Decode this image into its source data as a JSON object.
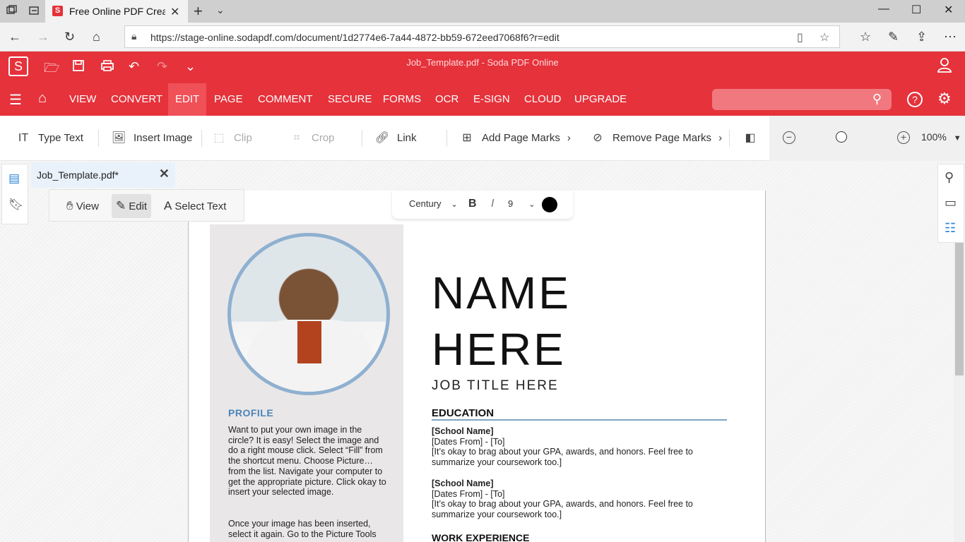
{
  "browser": {
    "tab_title": "Free Online PDF Creator",
    "favicon_letter": "S",
    "url": "https://stage-online.sodapdf.com/document/1d2774e6-7a44-4872-bb59-672eed7068f6?r=edit"
  },
  "app": {
    "logo": "S",
    "document_title": "Job_Template.pdf - Soda PDF Online",
    "menu": [
      "VIEW",
      "CONVERT",
      "EDIT",
      "PAGE",
      "COMMENT",
      "SECURE",
      "FORMS",
      "OCR",
      "E-SIGN",
      "CLOUD",
      "UPGRADE"
    ],
    "active_menu": "EDIT",
    "help_label": "?"
  },
  "ribbon": {
    "type_text": "Type Text",
    "insert_image": "Insert Image",
    "clip": "Clip",
    "crop": "Crop",
    "link": "Link",
    "add_page_marks": "Add Page Marks",
    "remove_page_marks": "Remove Page Marks",
    "zoom": "100%"
  },
  "workspace": {
    "doc_tab": "Job_Template.pdf*",
    "modes": {
      "view": "View",
      "edit": "Edit",
      "select_text": "Select Text"
    },
    "font": {
      "family": "Century",
      "bold": "B",
      "italic": "I",
      "size": "9",
      "color": "#000000"
    }
  },
  "resume": {
    "name_line1": "NAME",
    "name_line2": "HERE",
    "job_title": "JOB TITLE HERE",
    "profile_heading": "PROFILE",
    "profile_text": "Want to put your own image in the circle?  It is easy!  Select the image and do a right mouse click.  Select “Fill” from the shortcut menu.  Choose Picture… from the list.  Navigate your computer to get the appropriate picture.  Click okay to insert your selected image.",
    "profile_text2": "Once your image has been inserted, select it again.  Go to the Picture Tools",
    "education_heading": "EDUCATION",
    "entries": [
      {
        "school": "[School Name]",
        "dates": "[Dates From] - [To]",
        "desc": "[It’s okay to brag about your GPA, awards, and honors. Feel free to summarize your coursework too.]"
      },
      {
        "school": "[School Name]",
        "dates": "[Dates From] - [To]",
        "desc": "[It’s okay to brag about your GPA, awards, and honors. Feel free to summarize your coursework too.]"
      }
    ],
    "work_heading": "WORK EXPERIENCE"
  }
}
